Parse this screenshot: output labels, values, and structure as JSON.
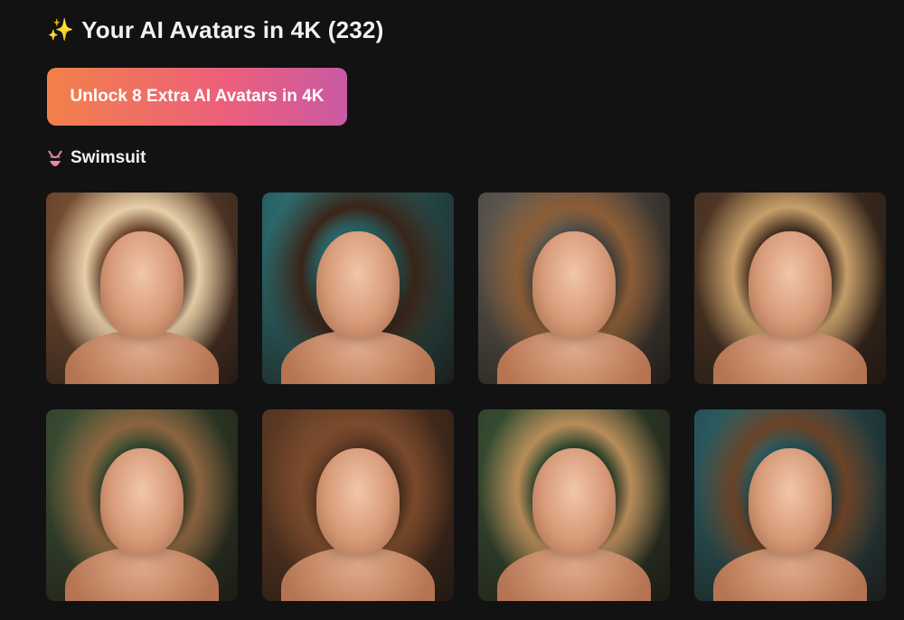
{
  "header": {
    "icon": "sparkles-icon",
    "title": "Your AI Avatars in 4K (232)"
  },
  "unlock_button": {
    "label": "Unlock 8 Extra AI Avatars in 4K",
    "gradient": [
      "#f2814a",
      "#ec5f7c",
      "#c95aa3"
    ]
  },
  "section": {
    "icon": "bikini-icon",
    "label": "Swimsuit"
  },
  "avatars": [
    {
      "alt": "avatar-1",
      "bg": "#8a5a3c",
      "hair": "#e7cfa8"
    },
    {
      "alt": "avatar-2",
      "bg": "#2f7f84",
      "hair": "#3a2418"
    },
    {
      "alt": "avatar-3",
      "bg": "#6a655d",
      "hair": "#8b5d36"
    },
    {
      "alt": "avatar-4",
      "bg": "#5b3f2b",
      "hair": "#c79f6a"
    },
    {
      "alt": "avatar-5",
      "bg": "#3f5a3a",
      "hair": "#8c6440"
    },
    {
      "alt": "avatar-6",
      "bg": "#6e4329",
      "hair": "#7a4a2c"
    },
    {
      "alt": "avatar-7",
      "bg": "#3c5a3a",
      "hair": "#b88c5a"
    },
    {
      "alt": "avatar-8",
      "bg": "#2d6b73",
      "hair": "#6b4226"
    }
  ]
}
